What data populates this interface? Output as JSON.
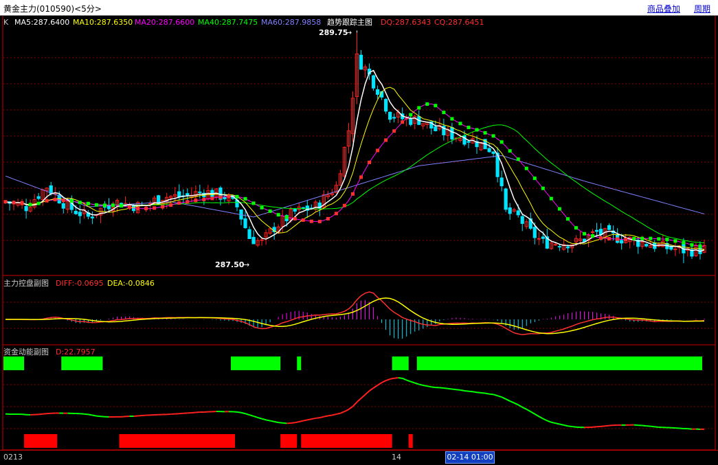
{
  "header": {
    "title": "黄金主力(010590)<5分>",
    "overlay_link": "商品叠加",
    "period_link": "周期"
  },
  "colors": {
    "bg": "#000000",
    "grid": "#8b0000",
    "up": "#ff2020",
    "down": "#00e5ff",
    "ma5": "#ffffff",
    "ma10": "#ffff00",
    "ma20": "#ff00ff",
    "ma40": "#00ff00",
    "ma60": "#8080ff",
    "dq": "#ff3030",
    "cq": "#ff3030",
    "green_bar": "#00ff00",
    "red_bar": "#ff0000",
    "diff": "#ff3030",
    "dea": "#ffff00"
  },
  "main_panel": {
    "prefix": "K",
    "ma5": "MA5:287.6400",
    "ma10": "MA10:287.6350",
    "ma20": "MA20:287.6600",
    "ma40": "MA40:287.7475",
    "ma60": "MA60:287.9858",
    "indicator": "趋势跟踪主图",
    "dq": "DQ:287.6343",
    "cq": "CQ:287.6451",
    "high_label": "289.75",
    "low_label": "287.50"
  },
  "sub_panel_1": {
    "title": "主力控盘副图",
    "diff": "DIFF:-0.0695",
    "dea": "DEA:-0.0846"
  },
  "sub_panel_2": {
    "title": "资金动能副图",
    "d": "D:22.7957"
  },
  "footer": {
    "start": "0213",
    "mid": "14",
    "cursor_time": "02-14 01:00"
  },
  "chart_data": {
    "type": "line",
    "y_range": [
      287.4,
      289.8
    ],
    "close_keypoints": [
      [
        0,
        288.1
      ],
      [
        5,
        288.05
      ],
      [
        10,
        288.25
      ],
      [
        15,
        288.05
      ],
      [
        20,
        287.95
      ],
      [
        26,
        288.1
      ],
      [
        33,
        288.05
      ],
      [
        38,
        288.15
      ],
      [
        43,
        288.15
      ],
      [
        48,
        288.2
      ],
      [
        53,
        288.15
      ],
      [
        56,
        288.05
      ],
      [
        59,
        287.75
      ],
      [
        62,
        287.7
      ],
      [
        65,
        287.85
      ],
      [
        70,
        288.0
      ],
      [
        75,
        288.05
      ],
      [
        80,
        288.25
      ],
      [
        83,
        288.8
      ],
      [
        85,
        289.5
      ],
      [
        87,
        289.4
      ],
      [
        90,
        289.2
      ],
      [
        93,
        288.95
      ],
      [
        97,
        288.9
      ],
      [
        100,
        288.9
      ],
      [
        104,
        288.8
      ],
      [
        108,
        288.75
      ],
      [
        113,
        288.7
      ],
      [
        118,
        288.6
      ],
      [
        121,
        288.0
      ],
      [
        124,
        287.95
      ],
      [
        127,
        287.8
      ],
      [
        130,
        287.7
      ],
      [
        133,
        287.7
      ],
      [
        138,
        287.7
      ],
      [
        143,
        287.8
      ],
      [
        148,
        287.75
      ],
      [
        154,
        287.7
      ],
      [
        160,
        287.65
      ],
      [
        165,
        287.62
      ],
      [
        169,
        287.64
      ]
    ],
    "ma60_keypoints": [
      [
        0,
        288.35
      ],
      [
        20,
        288.05
      ],
      [
        40,
        288.1
      ],
      [
        60,
        287.95
      ],
      [
        80,
        288.2
      ],
      [
        100,
        288.45
      ],
      [
        120,
        288.55
      ],
      [
        140,
        288.3
      ],
      [
        169,
        287.98
      ]
    ],
    "green_bars_ranges": [
      [
        0,
        5
      ],
      [
        14,
        24
      ],
      [
        55,
        67
      ],
      [
        71,
        72
      ],
      [
        94,
        98
      ],
      [
        100,
        169
      ]
    ],
    "red_bars_ranges": [
      [
        5,
        13
      ],
      [
        28,
        56
      ],
      [
        67,
        71
      ],
      [
        72,
        94
      ],
      [
        98,
        99
      ]
    ]
  }
}
